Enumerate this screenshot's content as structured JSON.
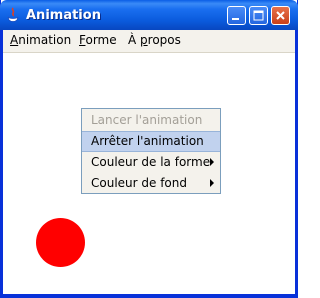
{
  "window": {
    "title": "Animation",
    "controls": {
      "minimize": "minimize-icon",
      "maximize": "maximize-icon",
      "close": "close-icon"
    }
  },
  "menubar": {
    "items": [
      {
        "label": "Animation",
        "mnemonic": "A"
      },
      {
        "label": "Forme",
        "mnemonic": "F"
      },
      {
        "label": "À propos",
        "mnemonic": "p"
      }
    ]
  },
  "popup_menu": {
    "items": [
      {
        "label": "Lancer l'animation",
        "enabled": false,
        "submenu": false
      },
      {
        "label": "Arrêter l'animation",
        "enabled": true,
        "highlighted": true,
        "submenu": false
      },
      {
        "label": "Couleur de la forme",
        "enabled": true,
        "submenu": true
      },
      {
        "label": "Couleur de fond",
        "enabled": true,
        "submenu": true
      }
    ]
  },
  "canvas": {
    "background_color": "#ffffff",
    "shape": {
      "type": "circle",
      "color": "#ff0000"
    }
  },
  "colors": {
    "titlebar": "#0a5adc",
    "menu_background": "#f4f2ec",
    "highlight": "#c1d2ee",
    "disabled_text": "#a39f97"
  }
}
